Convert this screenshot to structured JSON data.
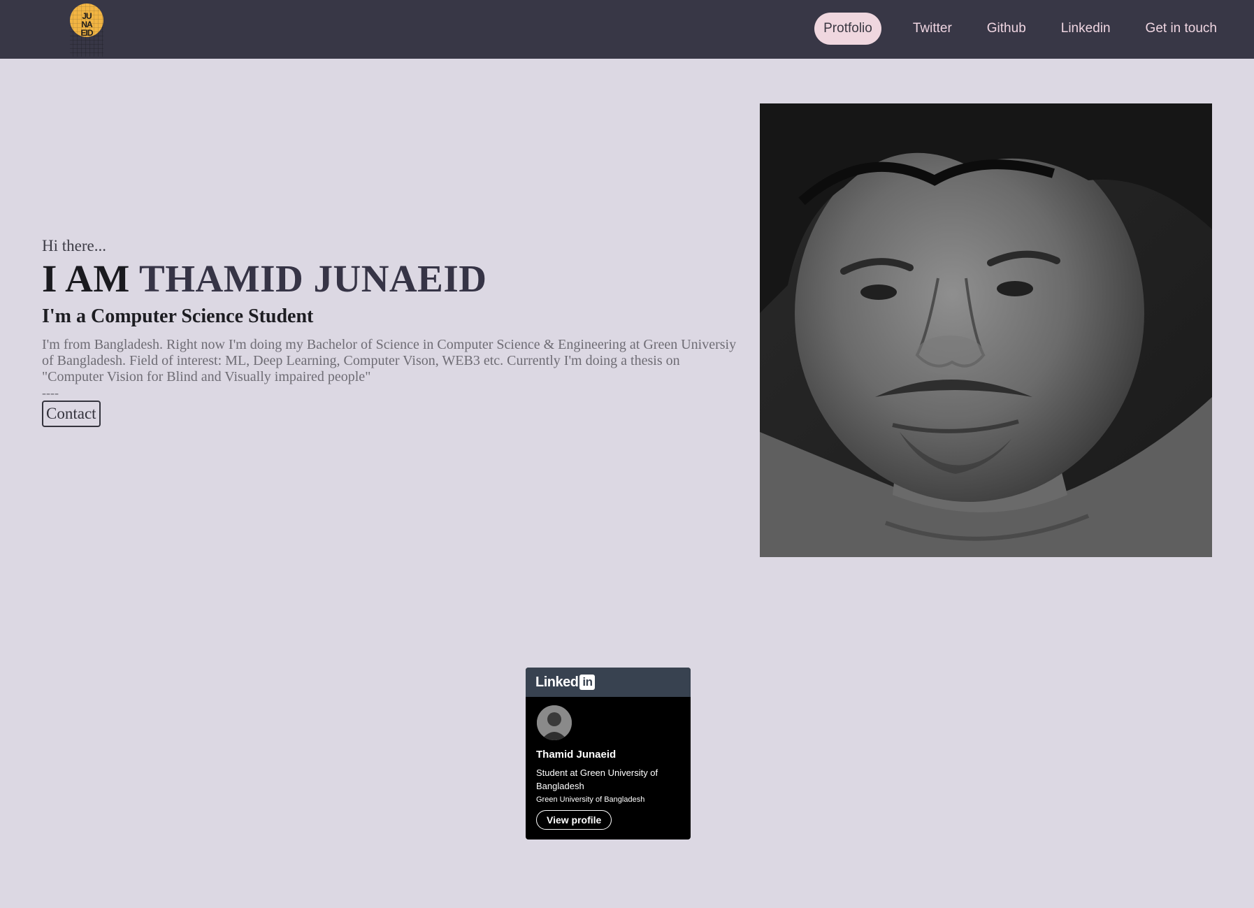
{
  "logo": {
    "text": "JU NA EID"
  },
  "nav": {
    "items": [
      {
        "label": "Protfolio",
        "active": true
      },
      {
        "label": "Twitter"
      },
      {
        "label": "Github"
      },
      {
        "label": "Linkedin"
      },
      {
        "label": "Get in touch"
      }
    ]
  },
  "hero": {
    "greeting": "Hi there...",
    "headline_prefix": "I AM ",
    "headline_name": "THAMID JUNAEID",
    "subtitle": "I'm a Computer Science Student",
    "bio": "I'm from Bangladesh. Right now I'm doing my Bachelor of Science in Computer Science & Engineering at Green Universiy of Bangladesh. Field of interest: ML, Deep Learning, Computer Vison, WEB3 etc. Currently I'm doing a thesis on \"Computer Vision for Blind and Visually impaired people\"",
    "divider": "----",
    "contact_label": "Contact"
  },
  "linkedin_badge": {
    "brand": "Linked",
    "brand_in": "in",
    "name": "Thamid Junaeid",
    "headline": "Student at Green University of Bangladesh",
    "company": "Green University of Bangladesh",
    "button_label": "View profile"
  },
  "colors": {
    "page_bg": "#dcd8e3",
    "navbar_bg": "#383746",
    "nav_text": "#f0d6e2",
    "nav_active_bg": "#efd7df",
    "logo_circle": "#f2b543",
    "badge_header": "#384250"
  }
}
